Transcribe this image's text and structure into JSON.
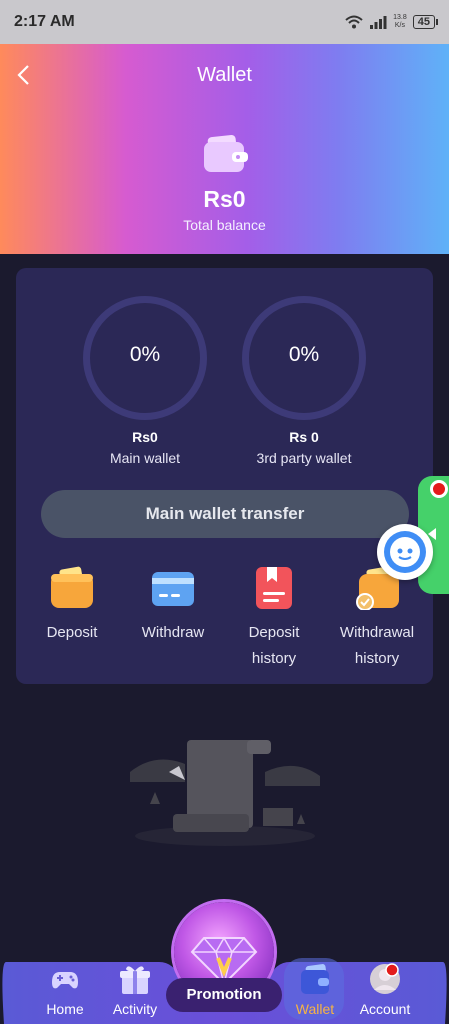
{
  "status_bar": {
    "time": "2:17 AM",
    "net_speed_value": "13.8",
    "net_speed_unit": "K/s",
    "battery": "45"
  },
  "header": {
    "title": "Wallet",
    "back_icon": "chevron-left-icon",
    "balance_amount": "Rs0",
    "balance_label": "Total balance"
  },
  "wallets": {
    "main": {
      "percent": "0%",
      "amount": "Rs0",
      "label": "Main wallet"
    },
    "third_party": {
      "percent": "0%",
      "amount": "Rs 0",
      "label": "3rd party wallet"
    }
  },
  "transfer_button": {
    "label": "Main wallet transfer"
  },
  "actions": [
    {
      "label": "Deposit",
      "icon": "deposit-icon"
    },
    {
      "label": "Withdraw",
      "icon": "withdraw-card-icon"
    },
    {
      "label_line1": "Deposit",
      "label_line2": "history",
      "icon": "deposit-history-icon"
    },
    {
      "label_line1": "Withdrawal",
      "label_line2": "history",
      "icon": "withdrawal-history-icon"
    }
  ],
  "bottom_nav": {
    "home": "Home",
    "activity": "Activity",
    "promotion": "Promotion",
    "wallet": "Wallet",
    "account": "Account",
    "active": "Wallet",
    "active_color": "#f6b444"
  },
  "colors": {
    "background": "#1b1a2e",
    "card": "#2b2856",
    "ring": "#3d3a78",
    "transfer_button": "#4a5367",
    "floating_tab": "#45d16a",
    "notification_dot": "#e31b1b"
  }
}
